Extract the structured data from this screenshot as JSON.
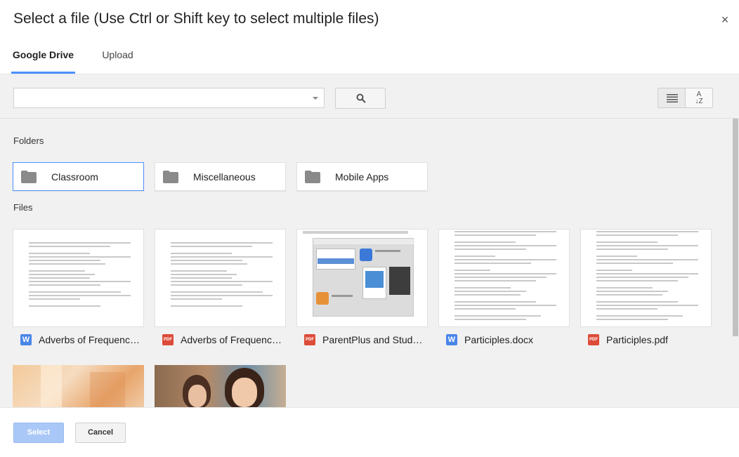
{
  "dialog": {
    "title": "Select a file (Use Ctrl or Shift key to select multiple files)",
    "close_label": "×"
  },
  "tabs": [
    {
      "label": "Google Drive",
      "active": true
    },
    {
      "label": "Upload",
      "active": false
    }
  ],
  "search": {
    "value": "",
    "placeholder": ""
  },
  "sections": {
    "folders_label": "Folders",
    "files_label": "Files"
  },
  "folders": [
    {
      "name": "Classroom",
      "selected": true
    },
    {
      "name": "Miscellaneous",
      "selected": false
    },
    {
      "name": "Mobile Apps",
      "selected": false
    }
  ],
  "files": [
    {
      "name": "Adverbs of Frequency.docx",
      "type": "doc",
      "type_label": "W"
    },
    {
      "name": "Adverbs of Frequency.pdf",
      "type": "pdf",
      "type_label": "PDF"
    },
    {
      "name": "ParentPlus and Student app.pdf",
      "type": "pdf",
      "type_label": "PDF"
    },
    {
      "name": "Participles.docx",
      "type": "doc",
      "type_label": "W"
    },
    {
      "name": "Participles.pdf",
      "type": "pdf",
      "type_label": "PDF"
    }
  ],
  "images": [
    {
      "name": "classroom-photo-1",
      "kind": "photo"
    },
    {
      "name": "classroom-photo-2",
      "kind": "photo"
    }
  ],
  "footer": {
    "select_label": "Select",
    "cancel_label": "Cancel"
  },
  "colors": {
    "accent": "#4d90fe",
    "doc_icon": "#4a86e8",
    "pdf_icon": "#dd4b39",
    "select_disabled": "#a9c8f8"
  }
}
